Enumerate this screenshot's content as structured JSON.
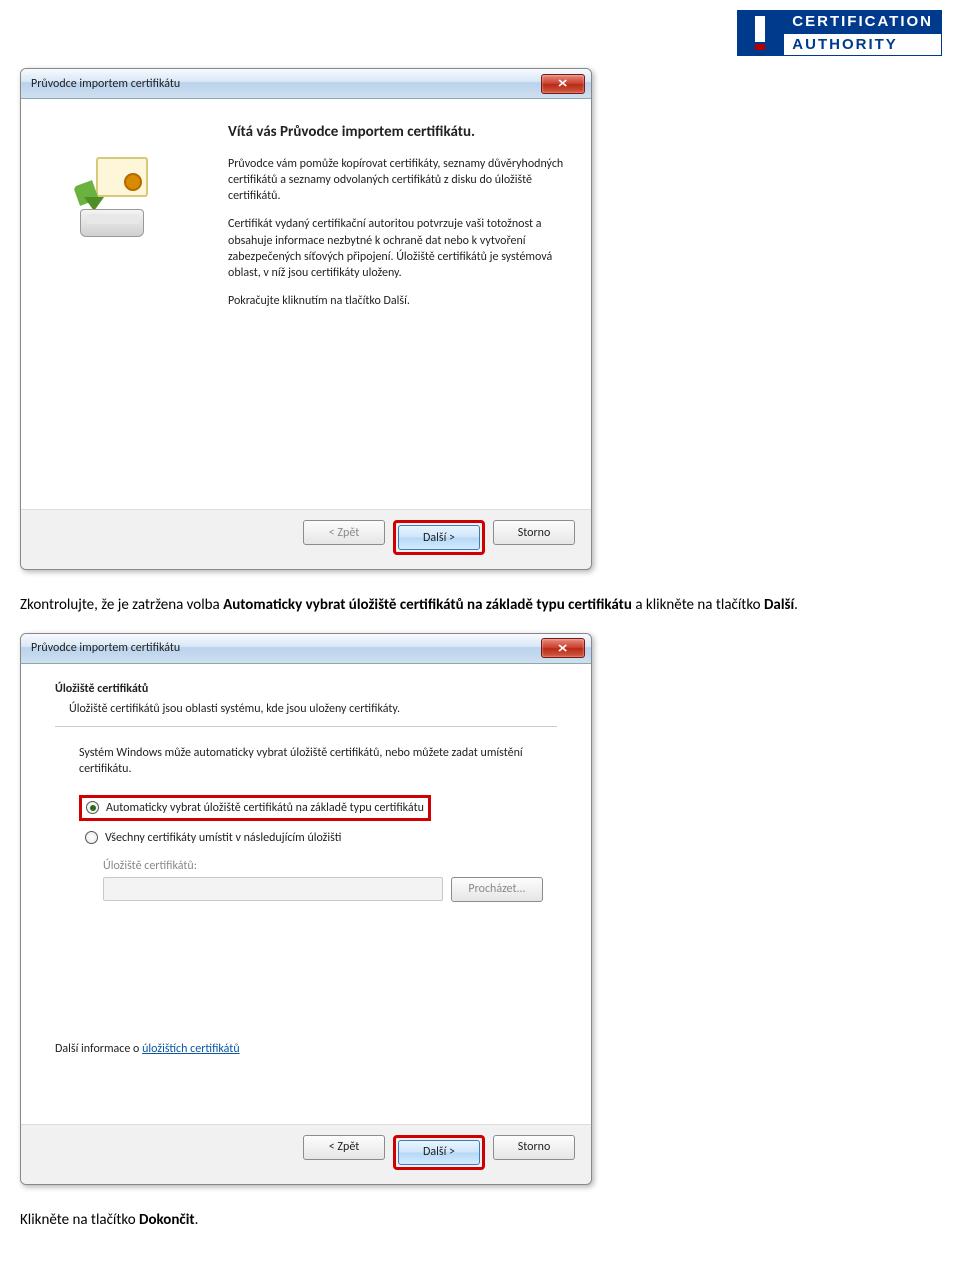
{
  "logo": {
    "line1": "CERTIFICATION",
    "line2": "AUTHORITY"
  },
  "dialog1": {
    "title": "Průvodce importem certifikátu",
    "heading": "Vítá vás Průvodce importem certifikátu.",
    "p1": "Průvodce vám pomůže kopírovat certifikáty, seznamy důvěryhodných certifikátů a seznamy odvolaných certifikátů z disku do úložiště certifikátů.",
    "p2": "Certifikát vydaný certifikační autoritou potvrzuje vaši totožnost a obsahuje informace nezbytné k ochraně dat nebo k vytvoření zabezpečených síťových připojení. Úložiště certifikátů je systémová oblast, v níž jsou certifikáty uloženy.",
    "p3": "Pokračujte kliknutím na tlačítko Další.",
    "back": "< Zpět",
    "next": "Další >",
    "cancel": "Storno"
  },
  "text1": {
    "pre": "Zkontrolujte, že je zatržena volba ",
    "bold": "Automaticky vybrat úložiště certifikátů na základě typu certifikátu",
    "post1": " a klikněte na tlačítko ",
    "bold2": "Další",
    "post2": "."
  },
  "dialog2": {
    "title": "Průvodce importem certifikátu",
    "h": "Úložiště certifikátů",
    "sub": "Úložiště certifikátů jsou oblasti systému, kde jsou uloženy certifikáty.",
    "intro": "Systém Windows může automaticky vybrat úložiště certifikátů, nebo můžete zadat umístění certifikátu.",
    "opt1": "Automaticky vybrat úložiště certifikátů na základě typu certifikátu",
    "opt2": "Všechny certifikáty umístit v následujícím úložišti",
    "fieldLabel": "Úložiště certifikátů:",
    "browse": "Procházet...",
    "morePre": "Další informace o ",
    "moreLink": "úložištích certifikátů",
    "back": "< Zpět",
    "next": "Další >",
    "cancel": "Storno"
  },
  "text2": {
    "pre": "Klikněte na tlačítko ",
    "bold": "Dokončit",
    "post": "."
  }
}
